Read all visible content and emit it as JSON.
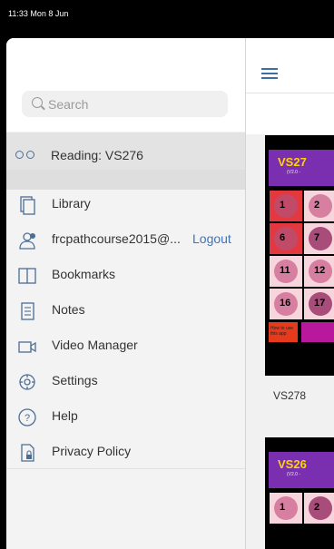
{
  "status_bar": {
    "time": "11:33  Mon 8 Jun"
  },
  "sidebar": {
    "search": {
      "placeholder": "Search"
    },
    "reading": {
      "label": "Reading: VS276"
    },
    "items": [
      {
        "label": "Library",
        "icon": "library-icon"
      },
      {
        "label": "frcpathcourse2015@...",
        "icon": "user-icon",
        "action": "Logout"
      },
      {
        "label": "Bookmarks",
        "icon": "bookmarks-icon"
      },
      {
        "label": "Notes",
        "icon": "notes-icon"
      },
      {
        "label": "Video Manager",
        "icon": "video-icon"
      },
      {
        "label": "Settings",
        "icon": "settings-icon"
      },
      {
        "label": "Help",
        "icon": "help-icon"
      },
      {
        "label": "Privacy Policy",
        "icon": "privacy-icon"
      }
    ]
  },
  "main": {
    "books": [
      {
        "header": "VS27",
        "sub": "(V2.0 -",
        "thumbs": [
          "1",
          "2",
          "6",
          "7",
          "11",
          "12",
          "16",
          "17"
        ],
        "howto": "How to use this app",
        "caption": "VS278"
      },
      {
        "header": "VS26",
        "sub": "(V2.0 -",
        "thumbs": [
          "1",
          "2"
        ]
      }
    ]
  },
  "colors": {
    "accent": "#3f73b8",
    "book_header": "#7a2fb0",
    "book_title": "#ffd400"
  }
}
